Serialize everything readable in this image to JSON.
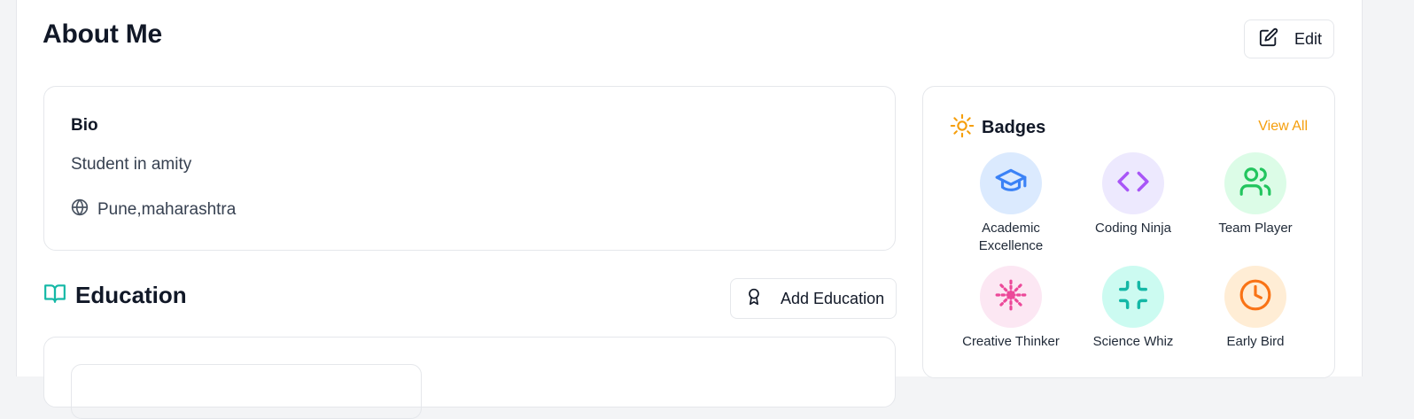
{
  "header": {
    "title": "About Me",
    "edit_label": "Edit"
  },
  "bio": {
    "label": "Bio",
    "text": "Student in amity",
    "location": "Pune,maharashtra",
    "location_icon": "globe-icon"
  },
  "education": {
    "title": "Education",
    "icon": "book-open-icon",
    "add_label": "Add Education",
    "add_icon": "award-icon"
  },
  "badges": {
    "title": "Badges",
    "icon": "sun-icon",
    "view_all": "View All",
    "accent_color": "#f59e0b",
    "items": [
      {
        "name": "Academic Excellence",
        "icon": "graduation-cap-icon",
        "bg": "#dbeafe",
        "fg": "#3b82f6"
      },
      {
        "name": "Coding Ninja",
        "icon": "code-icon",
        "bg": "#ede9fe",
        "fg": "#a855f7"
      },
      {
        "name": "Team Player",
        "icon": "users-icon",
        "bg": "#dcfce7",
        "fg": "#22c55e"
      },
      {
        "name": "Creative Thinker",
        "icon": "sparkle-icon",
        "bg": "#fce7f3",
        "fg": "#ec4899"
      },
      {
        "name": "Science Whiz",
        "icon": "shrink-icon",
        "bg": "#ccfbf1",
        "fg": "#14b8a6"
      },
      {
        "name": "Early Bird",
        "icon": "clock-icon",
        "bg": "#ffedd5",
        "fg": "#f97316"
      }
    ]
  }
}
